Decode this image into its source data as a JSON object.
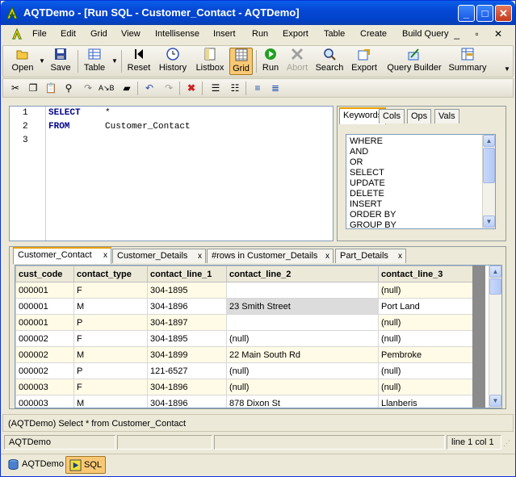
{
  "window": {
    "title": "AQTDemo - [Run SQL - Customer_Contact - AQTDemo]"
  },
  "menu": [
    "File",
    "Edit",
    "Grid",
    "View",
    "Intellisense",
    "Insert",
    "Run",
    "Export",
    "Table",
    "Create",
    "Build Query"
  ],
  "toolbar": {
    "open": "Open",
    "save": "Save",
    "table": "Table",
    "reset": "Reset",
    "history": "History",
    "listbox": "Listbox",
    "grid": "Grid",
    "run": "Run",
    "abort": "Abort",
    "search": "Search",
    "export": "Export",
    "query_builder": "Query Builder",
    "summary": "Summary"
  },
  "editor": {
    "lines": [
      {
        "num": "1",
        "kw": "SELECT",
        "rest": "*"
      },
      {
        "num": "2",
        "kw": "FROM",
        "rest": "Customer_Contact"
      },
      {
        "num": "3",
        "kw": "",
        "rest": ""
      }
    ]
  },
  "keywords_panel": {
    "tabs": [
      "Keywords",
      "Cols",
      "Ops",
      "Vals"
    ],
    "items": [
      "WHERE",
      "AND",
      "OR",
      "SELECT",
      "UPDATE",
      "DELETE",
      "INSERT",
      "ORDER BY",
      "GROUP BY"
    ]
  },
  "results": {
    "tabs": [
      "Customer_Contact",
      "Customer_Details",
      "#rows in Customer_Details",
      "Part_Details"
    ],
    "tab_close": "x",
    "columns": [
      "cust_code",
      "contact_type",
      "contact_line_1",
      "contact_line_2",
      "contact_line_3"
    ],
    "rows": [
      [
        "000001",
        "F",
        "304-1895",
        "",
        "(null)"
      ],
      [
        "000001",
        "M",
        "304-1896",
        "23 Smith Street",
        "Port Land"
      ],
      [
        "000001",
        "P",
        "304-1897",
        "",
        "(null)"
      ],
      [
        "000002",
        "F",
        "304-1895",
        "(null)",
        "(null)"
      ],
      [
        "000002",
        "M",
        "304-1899",
        "22 Main South Rd",
        "Pembroke"
      ],
      [
        "000002",
        "P",
        "121-6527",
        "(null)",
        "(null)"
      ],
      [
        "000003",
        "F",
        "304-1896",
        "(null)",
        "(null)"
      ],
      [
        "000003",
        "M",
        "304-1896",
        "878 Dixon St",
        "Llanberis"
      ]
    ]
  },
  "status": {
    "sql": "(AQTDemo) Select * from Customer_Contact",
    "connection": "AQTDemo",
    "position": "line 1 col 1"
  },
  "window_tabs": [
    "AQTDemo",
    "SQL"
  ]
}
